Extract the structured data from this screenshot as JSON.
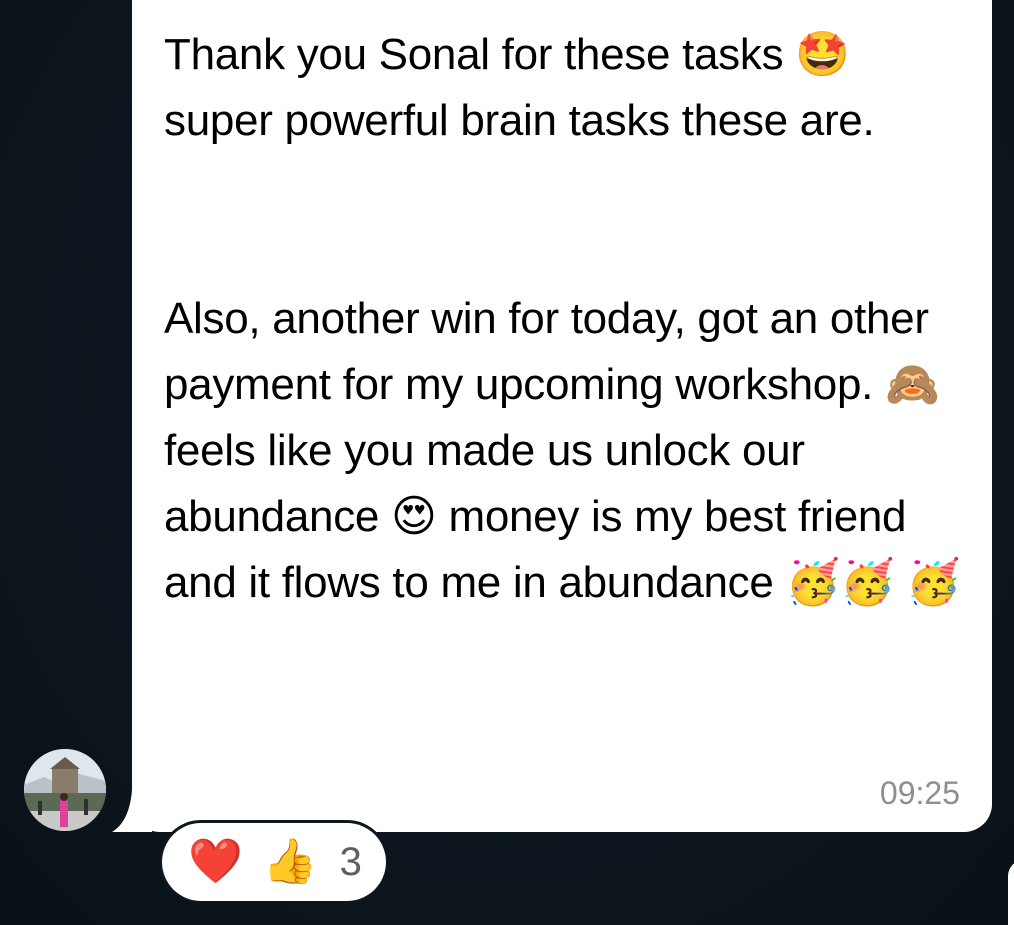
{
  "message": {
    "text": "Thank you Sonal for these tasks 🤩 super powerful brain tasks these are.\n\n\nAlso, another win for today, got an other payment for my upcoming workshop. 🙈 feels like you made us unlock our abundance 😍 money is my best friend and it flows to me in abundance 🥳🥳 🥳",
    "timestamp": "09:25"
  },
  "reactions": {
    "heart_icon": "❤️",
    "thumbs_up_icon": "👍",
    "count": "3"
  },
  "colors": {
    "background": "#0d161e",
    "bubble": "#ffffff",
    "text": "#000000",
    "timestamp": "#8e8e93"
  }
}
